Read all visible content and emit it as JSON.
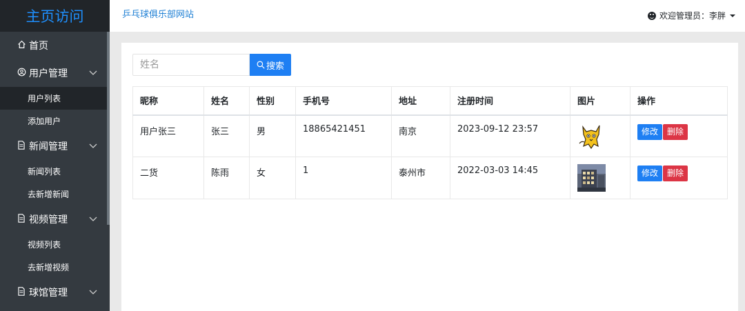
{
  "sidebar": {
    "brand": "主页访问",
    "items": [
      {
        "label": "首页",
        "icon": "home-icon"
      },
      {
        "label": "用户管理",
        "icon": "user-circle-icon"
      },
      {
        "label": "用户列表",
        "active": true
      },
      {
        "label": "添加用户"
      },
      {
        "label": "新闻管理",
        "icon": "document-icon"
      },
      {
        "label": "新闻列表"
      },
      {
        "label": "去新增新闻"
      },
      {
        "label": "视频管理",
        "icon": "document-icon"
      },
      {
        "label": "视频列表"
      },
      {
        "label": "去新增视频"
      },
      {
        "label": "球馆管理",
        "icon": "document-icon"
      }
    ]
  },
  "header": {
    "site_title": "乒乓球俱乐部网站",
    "user_label": "欢迎管理员：李胖"
  },
  "search": {
    "placeholder": "姓名",
    "value": "",
    "button_label": "搜索"
  },
  "table": {
    "columns": [
      "昵称",
      "姓名",
      "性别",
      "手机号",
      "地址",
      "注册时间",
      "图片",
      "操作"
    ],
    "rows": [
      {
        "nickname": "用户张三",
        "name": "张三",
        "gender": "男",
        "phone": "18865421451",
        "address": "南京",
        "registered": "2023-09-12 23:57",
        "image": "tomcat-cat-image",
        "edit": "修改",
        "delete": "删除"
      },
      {
        "nickname": "二货",
        "name": "陈雨",
        "gender": "女",
        "phone": "1",
        "address": "泰州市",
        "registered": "2022-03-03 14:45",
        "image": "building-photo-image",
        "edit": "修改",
        "delete": "删除"
      }
    ]
  },
  "colors": {
    "sidebar_bg": "#343a40",
    "brand_bg": "#212529",
    "brand_text": "#1e90ff",
    "primary": "#1e7ff3",
    "danger": "#dc3545"
  }
}
